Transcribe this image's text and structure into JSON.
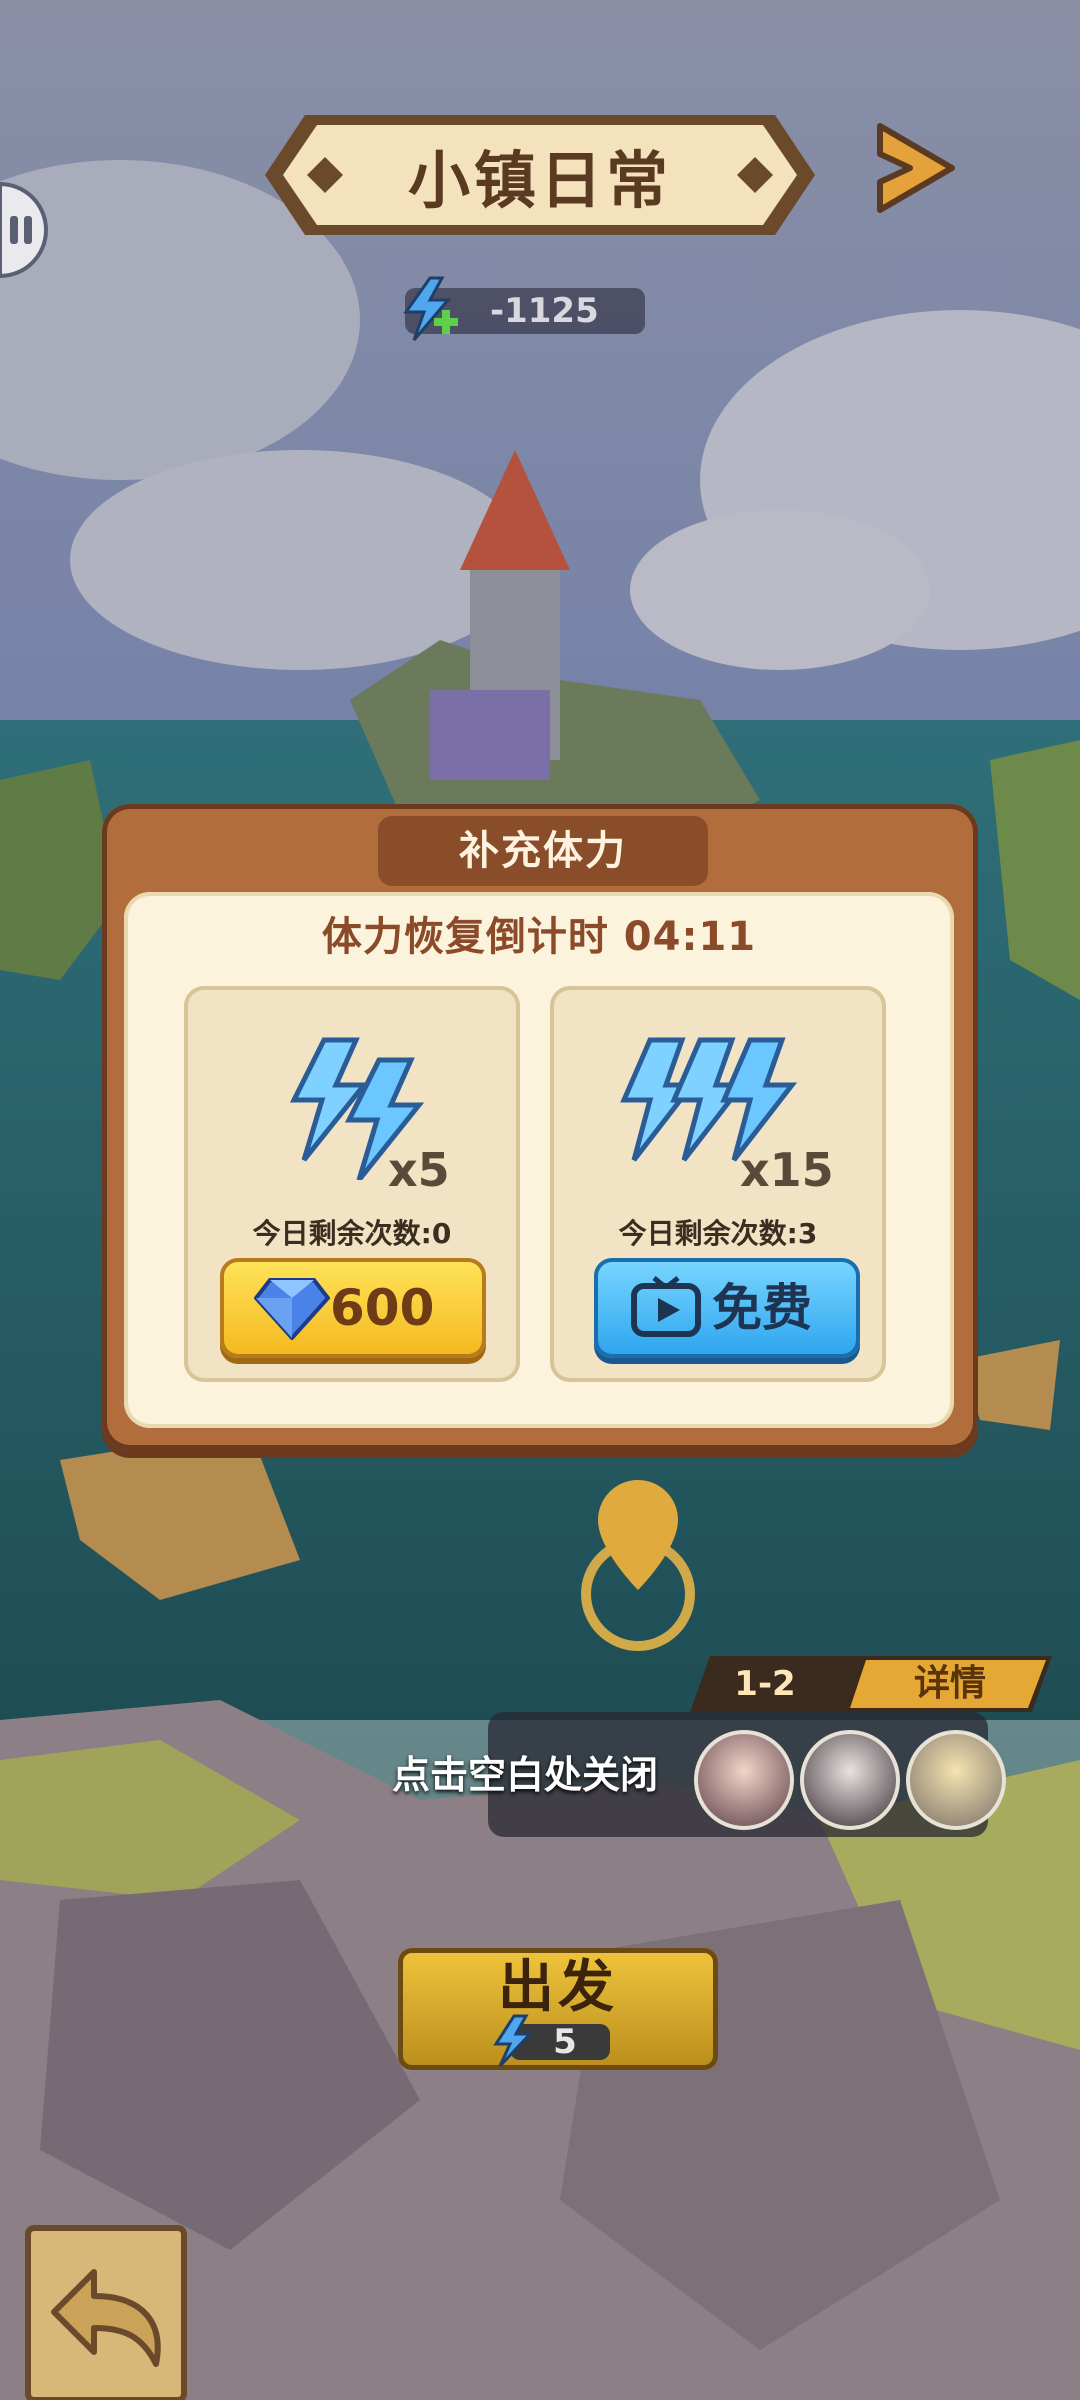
{
  "header": {
    "title": "小镇日常"
  },
  "energy": {
    "value": "-1125"
  },
  "modal": {
    "title": "补充体力",
    "countdown": "体力恢复倒计时 04:11",
    "options": [
      {
        "multiplier": "x5",
        "remain": "今日剩余次数:0",
        "button_label": "600",
        "button_icon": "diamond-icon"
      },
      {
        "multiplier": "x15",
        "remain": "今日剩余次数:3",
        "button_label": "免费",
        "button_icon": "tv-icon"
      }
    ]
  },
  "level": {
    "stage": "1-2",
    "detail_label": "详情"
  },
  "overlay": {
    "close_hint": "点击空白处关闭"
  },
  "go_button": {
    "label": "出发",
    "cost": "5"
  },
  "colors": {
    "modal_frame": "#b26d3d",
    "modal_bg": "#fbf3dc",
    "gold_button": "#f4b81f",
    "blue_button": "#2ca4ef",
    "title_text": "#5a3b22"
  }
}
